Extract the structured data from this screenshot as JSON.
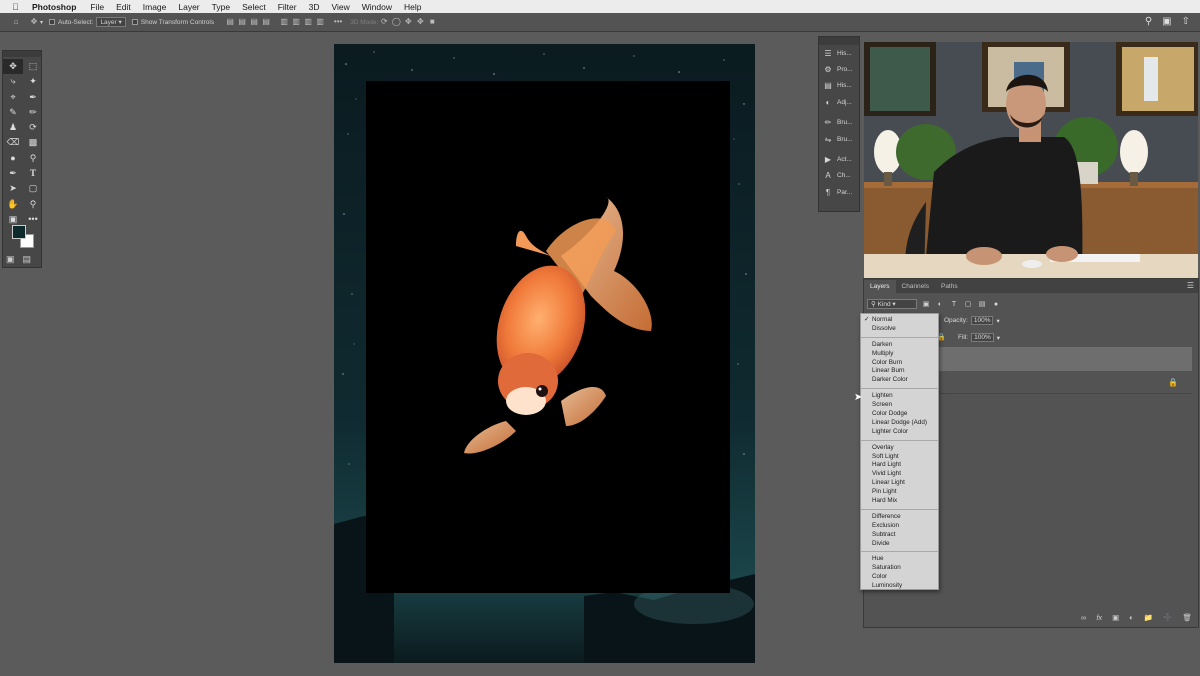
{
  "menubar": {
    "app": "Photoshop",
    "items": [
      "File",
      "Edit",
      "Image",
      "Layer",
      "Type",
      "Select",
      "Filter",
      "3D",
      "View",
      "Window",
      "Help"
    ]
  },
  "options": {
    "auto_select_label": "Auto-Select:",
    "auto_select_value": "Layer",
    "transform_label": "Show Transform Controls",
    "mode_3d_label": "3D Mode:"
  },
  "icon_column": [
    {
      "icon": "history-icon",
      "label": "His..."
    },
    {
      "icon": "properties-icon",
      "label": "Pro..."
    },
    {
      "icon": "histogram-icon",
      "label": "His..."
    },
    {
      "icon": "adjustments-icon",
      "label": "Adj..."
    },
    {
      "icon": "brush-icon",
      "label": "Bru..."
    },
    {
      "icon": "brush-settings-icon",
      "label": "Bru..."
    },
    {
      "icon": "actions-icon",
      "label": "Act..."
    },
    {
      "icon": "character-icon",
      "label": "Ch..."
    },
    {
      "icon": "paragraph-icon",
      "label": "Par..."
    }
  ],
  "layers_panel": {
    "tabs": [
      "Layers",
      "Channels",
      "Paths"
    ],
    "active_tab": "Layers",
    "filter_kind": "Kind",
    "opacity_label": "Opacity:",
    "opacity_value": "100%",
    "fill_label": "Fill:",
    "fill_value": "100%"
  },
  "blend_modes": {
    "selected": "Normal",
    "groups": [
      [
        "Normal",
        "Dissolve"
      ],
      [
        "Darken",
        "Multiply",
        "Color Burn",
        "Linear Burn",
        "Darker Color"
      ],
      [
        "Lighten",
        "Screen",
        "Color Dodge",
        "Linear Dodge (Add)",
        "Lighter Color"
      ],
      [
        "Overlay",
        "Soft Light",
        "Hard Light",
        "Vivid Light",
        "Linear Light",
        "Pin Light",
        "Hard Mix"
      ],
      [
        "Difference",
        "Exclusion",
        "Subtract",
        "Divide"
      ],
      [
        "Hue",
        "Saturation",
        "Color",
        "Luminosity"
      ]
    ]
  },
  "colors": {
    "foreground": "#0d2a2c",
    "background": "#ffffff"
  }
}
